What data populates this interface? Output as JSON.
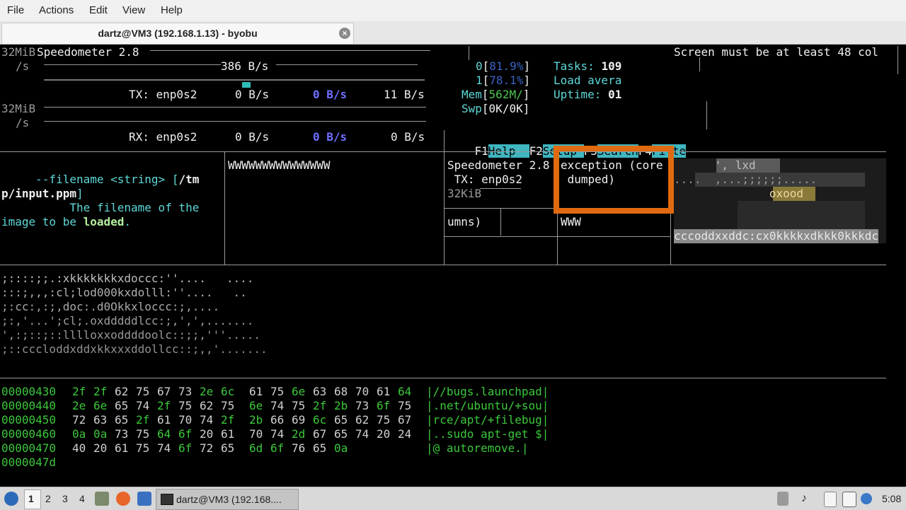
{
  "menu": [
    "File",
    "Actions",
    "Edit",
    "View",
    "Help"
  ],
  "tab": {
    "title": "dartz@VM3 (192.168.1.13) - byobu",
    "close": "×"
  },
  "speedometer": {
    "ylabel1": "32MiB",
    "ylabel1_unit": "/s",
    "title": "Speedometer 2.8",
    "rate_top": "386 B/s",
    "tx_label": "TX: enp0s2",
    "tx_a": "0 B/s",
    "tx_b": "0 B/s",
    "tx_c": "11 B/s",
    "ylabel2": "32MiB",
    "ylabel2_unit": "/s",
    "rx_label": "RX: enp0s2",
    "rx_a": "0 B/s",
    "rx_b": "0 B/s",
    "rx_c": "0 B/s",
    "tx_level_fraction": 0.02
  },
  "screen_warning": "Screen must be at least 48 col",
  "htop": {
    "cpu0_num": "0",
    "cpu0_val": "81.9%",
    "cpu1_num": "1",
    "cpu1_val": "78.1%",
    "mem_label": "Mem",
    "mem_val": "562M/",
    "swp_label": "Swp",
    "swp_val": "0K/0K",
    "tasks_label": "Tasks: ",
    "tasks_val": "109",
    "load_label": "Load avera",
    "uptime_label": "Uptime: ",
    "uptime_val": "01",
    "fkeys": [
      {
        "key": "F1",
        "label": "Help  "
      },
      {
        "key": "F2",
        "label": "Setup "
      },
      {
        "key": "F3",
        "label": "Search"
      },
      {
        "key": "F4",
        "label": "Filte"
      }
    ]
  },
  "helptext": {
    "line1": "     --filename <string> [",
    "line1_path": "/tm",
    "line2_path": "p/input.ppm",
    "line2_end": "]",
    "line3": "          The filename of the",
    "line4": "image to be ",
    "line4_bold": "loaded",
    "line4_end": "."
  },
  "wpane": {
    "text": "WWWWWWWWWWWWWWW"
  },
  "mini": {
    "title": "Speedometer 2.8",
    "tx": " TX: enp0s2",
    "ylabel": "32KiB",
    "exception_1": "exception (core",
    "exception_2": " dumped)",
    "columns": "umns)",
    "www": "WWW"
  },
  "ascii_small": {
    "row1": "      ', lxd        ",
    "row2": "....  ,...;;;;;;.....",
    "row3": "              oxood  ",
    "row4": "cccoddxxddc:cx0kkkkxdkkk0kkkdc"
  },
  "ascii_art": [
    ";::::;;.:xkkkkkkkxdoccc:''....   ....",
    ":::;,,,:cl;lod000kxdolll:''....   ..",
    ";:cc:,:;,doc:.d0Okkxloccc:;,....",
    ";:,'...';cl;.oxdddddlcc:;,',',.......",
    "',:;::;::lllloxxoddddoolc::;;,'''.....",
    ";::cccloddxddxkkxxxddollcc::;,,'......."
  ],
  "hexdump": [
    {
      "addr": "00000430",
      "bytes": [
        "2f",
        "2f",
        "62",
        "75",
        "67",
        "73",
        "2e",
        "6c",
        "61",
        "75",
        "6e",
        "63",
        "68",
        "70",
        "61",
        "64"
      ],
      "ascii": "|//bugs.launchpad|"
    },
    {
      "addr": "00000440",
      "bytes": [
        "2e",
        "6e",
        "65",
        "74",
        "2f",
        "75",
        "62",
        "75",
        "6e",
        "74",
        "75",
        "2f",
        "2b",
        "73",
        "6f",
        "75"
      ],
      "ascii": "|.net/ubuntu/+sou|"
    },
    {
      "addr": "00000450",
      "bytes": [
        "72",
        "63",
        "65",
        "2f",
        "61",
        "70",
        "74",
        "2f",
        "2b",
        "66",
        "69",
        "6c",
        "65",
        "62",
        "75",
        "67"
      ],
      "ascii": "|rce/apt/+filebug|"
    },
    {
      "addr": "00000460",
      "bytes": [
        "0a",
        "0a",
        "73",
        "75",
        "64",
        "6f",
        "20",
        "61",
        "70",
        "74",
        "2d",
        "67",
        "65",
        "74",
        "20",
        "24"
      ],
      "ascii": "|..sudo apt-get $|"
    },
    {
      "addr": "00000470",
      "bytes": [
        "40",
        "20",
        "61",
        "75",
        "74",
        "6f",
        "72",
        "65",
        "6d",
        "6f",
        "76",
        "65",
        "0a"
      ],
      "ascii": "|@ autoremove.|"
    },
    {
      "addr": "0000047d",
      "bytes": [],
      "ascii": ""
    }
  ],
  "taskbar": {
    "workspaces": [
      "1",
      "2",
      "3",
      "4"
    ],
    "window": "dartz@VM3 (192.168....",
    "clock": "5:08"
  }
}
